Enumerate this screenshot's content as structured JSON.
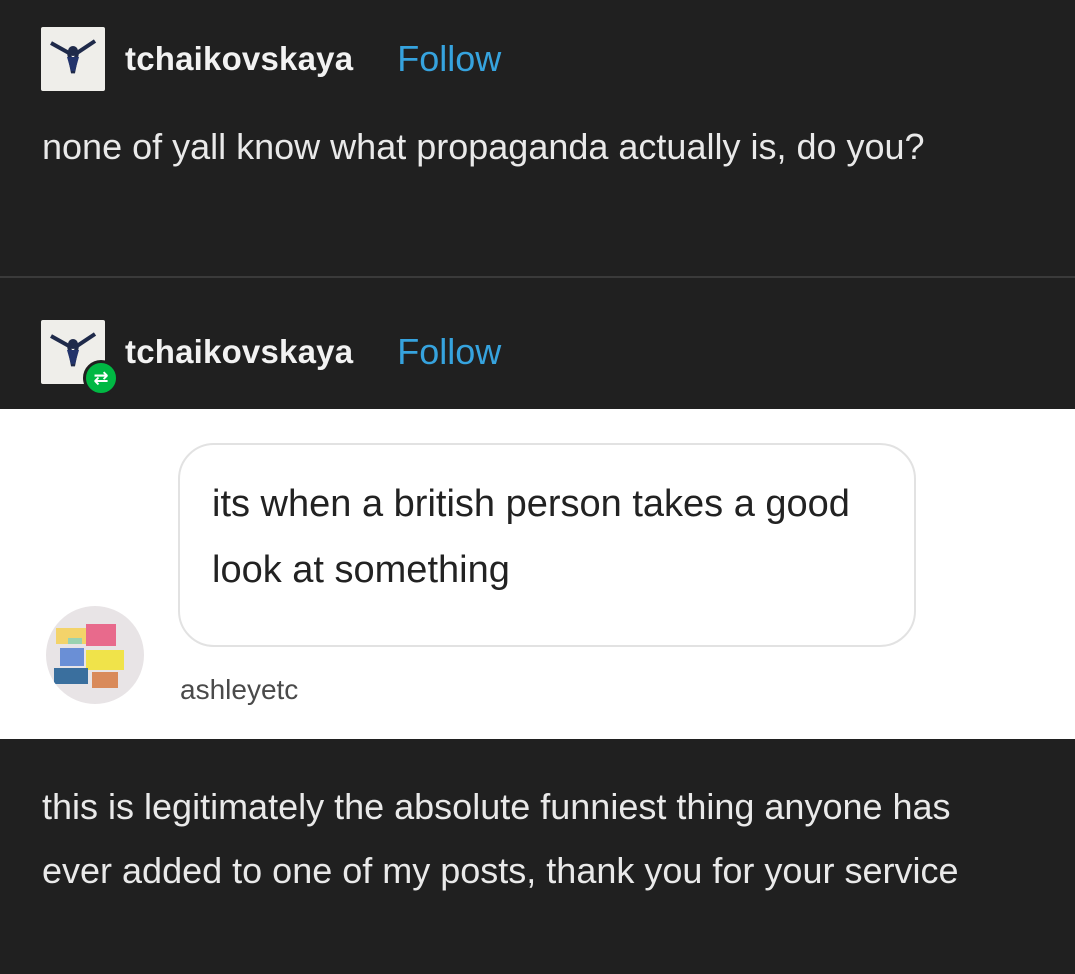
{
  "original_post": {
    "username": "tchaikovskaya",
    "follow_label": "Follow",
    "text": "none of yall know what propaganda actually is, do you?"
  },
  "reblog": {
    "username": "tchaikovskaya",
    "follow_label": "Follow",
    "reblog_icon": "reblog-arrows-icon",
    "comment_username": "ashleyetc",
    "comment_text": "its when a british person takes a good look at something",
    "text": "this is legitimately the absolute funniest thing anyone has ever added to one of my posts, thank you for your service"
  },
  "colors": {
    "background": "#202020",
    "follow_link": "#36a3de",
    "reblog_badge": "#00b843"
  }
}
